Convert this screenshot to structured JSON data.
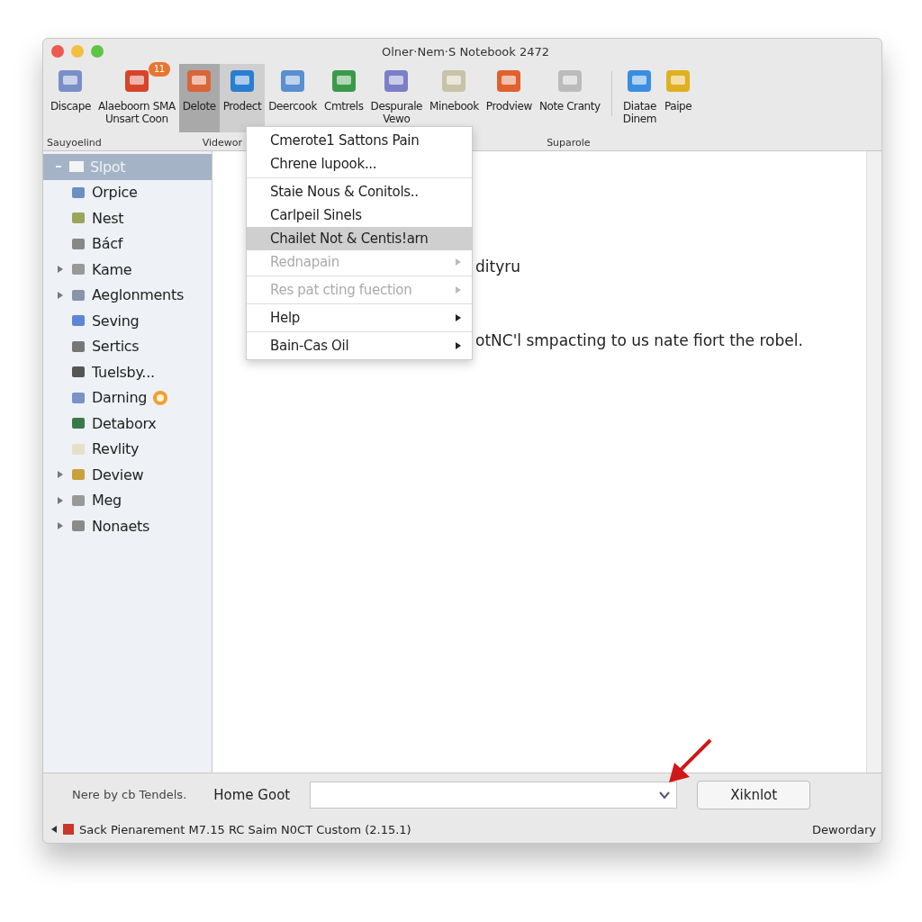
{
  "window": {
    "title": "Olner·Nem·S Notebook 2472"
  },
  "toolbar": {
    "items": [
      {
        "label": "Discape",
        "selected": false
      },
      {
        "label": "Alaeboorn SMA\nUnsart Coon",
        "badge": "11",
        "selected": false
      },
      {
        "label": "Delote",
        "selected": true
      },
      {
        "label": "Prodect",
        "selected": false,
        "hover": true
      },
      {
        "label": "Deercook",
        "selected": false
      },
      {
        "label": "Cmtrels",
        "selected": false
      },
      {
        "label": "Despurale\nVewo",
        "selected": false
      },
      {
        "label": "Minebook",
        "selected": false
      },
      {
        "label": "Prodview",
        "selected": false
      },
      {
        "label": "Note Cranty",
        "selected": false
      },
      {
        "label": "Diatae\nDinem",
        "selected": false
      },
      {
        "label": "Paipe",
        "selected": false
      }
    ],
    "groups": [
      "Sauyoelind",
      "Videwor",
      "Suparole"
    ]
  },
  "sidebar": {
    "items": [
      {
        "label": "Slpot",
        "kind": "folder",
        "expanded": true,
        "selected": true,
        "children": [
          {
            "label": "Orpice",
            "kind": "leaf",
            "selected": false
          },
          {
            "label": "Nest",
            "kind": "leaf",
            "selected": false
          },
          {
            "label": "Bácf",
            "kind": "leaf",
            "selected": false
          },
          {
            "label": "Kame",
            "kind": "folder",
            "expanded": false,
            "selected": false
          },
          {
            "label": "Aeglonments",
            "kind": "folder",
            "expanded": false,
            "selected": false
          },
          {
            "label": "Seving",
            "kind": "leaf",
            "selected": false
          },
          {
            "label": "Sertics",
            "kind": "leaf",
            "selected": false
          },
          {
            "label": "Tuelsby...",
            "kind": "leaf",
            "selected": false
          },
          {
            "label": "Darning",
            "kind": "leaf",
            "selected": false,
            "alert": true
          },
          {
            "label": "Detaborx",
            "kind": "leaf",
            "selected": false
          },
          {
            "label": "Revlity",
            "kind": "leaf",
            "selected": false
          },
          {
            "label": "Deview",
            "kind": "folder",
            "expanded": false,
            "selected": false
          },
          {
            "label": "Meg",
            "kind": "folder",
            "expanded": false,
            "selected": false
          },
          {
            "label": "Nonaets",
            "kind": "folder",
            "expanded": false,
            "selected": false
          }
        ]
      }
    ]
  },
  "content": {
    "lines": [
      "dityru",
      "otNC'l smpacting to us nate fiort the robel."
    ]
  },
  "context_menu": {
    "items": [
      {
        "kind": "item",
        "label": "Cmerote1 Sattons Pain",
        "selected": false,
        "disabled": false
      },
      {
        "kind": "item",
        "label": "Chrene lupook...",
        "selected": false,
        "disabled": false
      },
      {
        "kind": "separator"
      },
      {
        "kind": "item",
        "label": "Staie Nous & Conitols..",
        "selected": false,
        "disabled": false
      },
      {
        "kind": "item",
        "label": "Carlpeil Sinels",
        "selected": false,
        "disabled": false
      },
      {
        "kind": "item",
        "label": "Chailet Not & Centis!arn",
        "selected": true,
        "disabled": false
      },
      {
        "kind": "submenu",
        "label": "Rednapain",
        "selected": false,
        "disabled": true
      },
      {
        "kind": "separator"
      },
      {
        "kind": "submenu",
        "label": "Res pat cting fuection",
        "selected": false,
        "disabled": true
      },
      {
        "kind": "separator"
      },
      {
        "kind": "submenu",
        "label": "Help",
        "selected": false,
        "disabled": false
      },
      {
        "kind": "separator"
      },
      {
        "kind": "submenu",
        "label": "Bain-Cas Oil",
        "selected": false,
        "disabled": false
      }
    ]
  },
  "bottom_bar": {
    "note": "Nere by cb Tendels.",
    "field_label": "Home Goot",
    "button": "Xiknlot"
  },
  "status_bar": {
    "text": "Sack Pienarement M7.15 RC Saim N0CT Custom (2.15.1)",
    "right": "Dewordary"
  }
}
